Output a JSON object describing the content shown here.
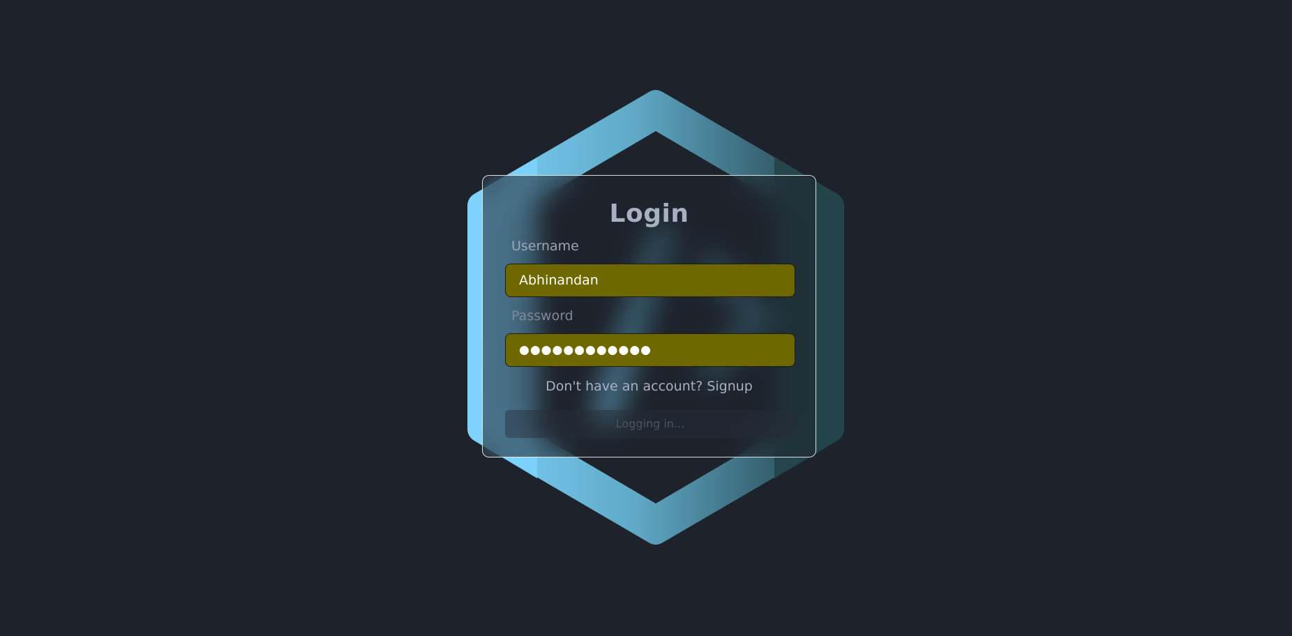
{
  "login_form": {
    "title": "Login",
    "username_label": "Username",
    "username_value": "Abhinandan",
    "password_label": "Password",
    "password_value": "●●●●●●●●●●●●",
    "signup_prompt": "Don't have an account?",
    "signup_link": "Signup",
    "submit_label": "Logging in..."
  },
  "colors": {
    "background": "#1e232b",
    "input_fill": "#6f6800",
    "hexagon_light": "#7dd3fc",
    "hexagon_dark": "#1f3a40",
    "label_text": "#a7b1c2"
  },
  "icons": {
    "background_logo": "hexagon-logo-icon"
  }
}
